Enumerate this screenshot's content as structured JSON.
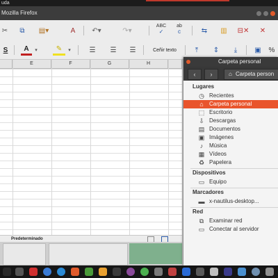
{
  "topbar": {
    "left_text": "uda"
  },
  "browser": {
    "title": "Mozilla Firefox"
  },
  "toolbar": {
    "styles_label": "S",
    "font_color_label": "A",
    "wrap_text_label": "Ceñir texto",
    "abc_label": "ABC",
    "abc2_label": "ab"
  },
  "sheet": {
    "columns": [
      "E",
      "F",
      "G",
      "H"
    ],
    "status_style": "Predeterminado"
  },
  "nautilus": {
    "title": "Carpeta personal",
    "path": "Carpeta person",
    "sections": {
      "places": "Lugares",
      "devices": "Dispositivos",
      "bookmarks": "Marcadores",
      "network": "Red"
    },
    "places": [
      {
        "label": "Recientes",
        "icon": "clock-icon"
      },
      {
        "label": "Carpeta personal",
        "icon": "home-icon"
      },
      {
        "label": "Escritorio",
        "icon": "desktop-icon"
      },
      {
        "label": "Descargas",
        "icon": "download-icon"
      },
      {
        "label": "Documentos",
        "icon": "document-icon"
      },
      {
        "label": "Imágenes",
        "icon": "image-icon"
      },
      {
        "label": "Música",
        "icon": "music-icon"
      },
      {
        "label": "Vídeos",
        "icon": "video-icon"
      },
      {
        "label": "Papelera",
        "icon": "trash-icon"
      }
    ],
    "devices": [
      {
        "label": "Equipo",
        "icon": "computer-icon"
      }
    ],
    "bookmarks": [
      {
        "label": "x-nautilus-desktop...",
        "icon": "folder-icon"
      }
    ],
    "network": [
      {
        "label": "Examinar red",
        "icon": "network-icon"
      },
      {
        "label": "Conectar al servidor",
        "icon": "server-icon"
      }
    ]
  },
  "colors": {
    "accent": "#e9542c",
    "dark_header": "#383838"
  }
}
